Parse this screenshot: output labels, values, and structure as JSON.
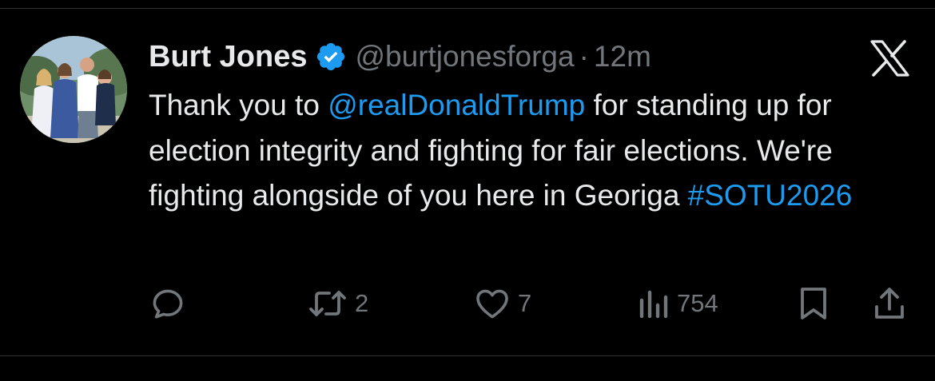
{
  "author": {
    "display_name": "Burt Jones",
    "handle": "@burtjonesforga",
    "separator": "·",
    "time": "12m"
  },
  "tweet": {
    "text_before_mention": "Thank you to ",
    "mention": "@realDonaldTrump",
    "text_after_mention": " for standing up for election integrity and fighting for fair elections. We're fighting alongside of you here in Georiga ",
    "hashtag": "#SOTU2026"
  },
  "actions": {
    "reply_icon": "reply-icon",
    "retweet_icon": "retweet-icon",
    "retweet_count": "2",
    "like_icon": "heart-icon",
    "like_count": "7",
    "views_icon": "analytics-icon",
    "views_count": "754",
    "bookmark_icon": "bookmark-icon",
    "share_icon": "share-icon"
  },
  "colors": {
    "background": "#000000",
    "text": "#e7e9ea",
    "secondary": "#71767b",
    "link": "#1d9bf0",
    "verified": "#1d9bf0"
  }
}
